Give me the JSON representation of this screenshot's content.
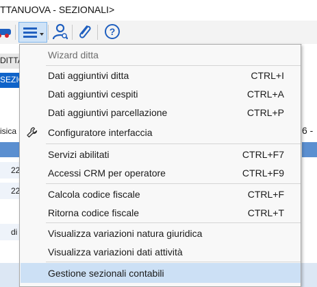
{
  "window": {
    "title": "TTANUOVA - SEZIONALI>"
  },
  "toolbar": {
    "buttons": [
      {
        "name": "car-icon"
      },
      {
        "name": "menu-icon",
        "active": true
      },
      {
        "name": "user-config-icon"
      },
      {
        "name": "paperclip-icon"
      },
      {
        "name": "help-icon"
      }
    ]
  },
  "background": {
    "left_col_header": "DITTA",
    "left_selected": "SEZIO",
    "left_tab": "isica",
    "right_fragment": "6 -",
    "rows": [
      "22",
      "22",
      "di"
    ]
  },
  "menu": {
    "header": "Wizard ditta",
    "items": [
      {
        "label": "Dati aggiuntivi ditta",
        "shortcut": "CTRL+I"
      },
      {
        "label": "Dati aggiuntivi cespiti",
        "shortcut": "CTRL+A"
      },
      {
        "label": "Dati aggiuntivi parcellazione",
        "shortcut": "CTRL+P"
      },
      {
        "label": "Configuratore interfaccia",
        "shortcut": "",
        "icon": "wrench-icon"
      },
      {
        "label": "Servizi abilitati",
        "shortcut": "CTRL+F7"
      },
      {
        "label": "Accessi CRM per operatore",
        "shortcut": "CTRL+F9"
      },
      {
        "label": "Calcola codice fiscale",
        "shortcut": "CTRL+F"
      },
      {
        "label": "Ritorna codice fiscale",
        "shortcut": "CTRL+T"
      },
      {
        "label": "Visualizza variazioni natura giuridica",
        "shortcut": ""
      },
      {
        "label": "Visualizza variazioni dati attività",
        "shortcut": ""
      },
      {
        "label": "Gestione sezionali contabili",
        "shortcut": "",
        "highlighted": true
      }
    ]
  },
  "colors": {
    "highlight": "#cce0f5",
    "toolbar_active": "#cfe3f7",
    "accent_blue": "#1f5fbf",
    "selection_blue": "#0f63c9"
  }
}
